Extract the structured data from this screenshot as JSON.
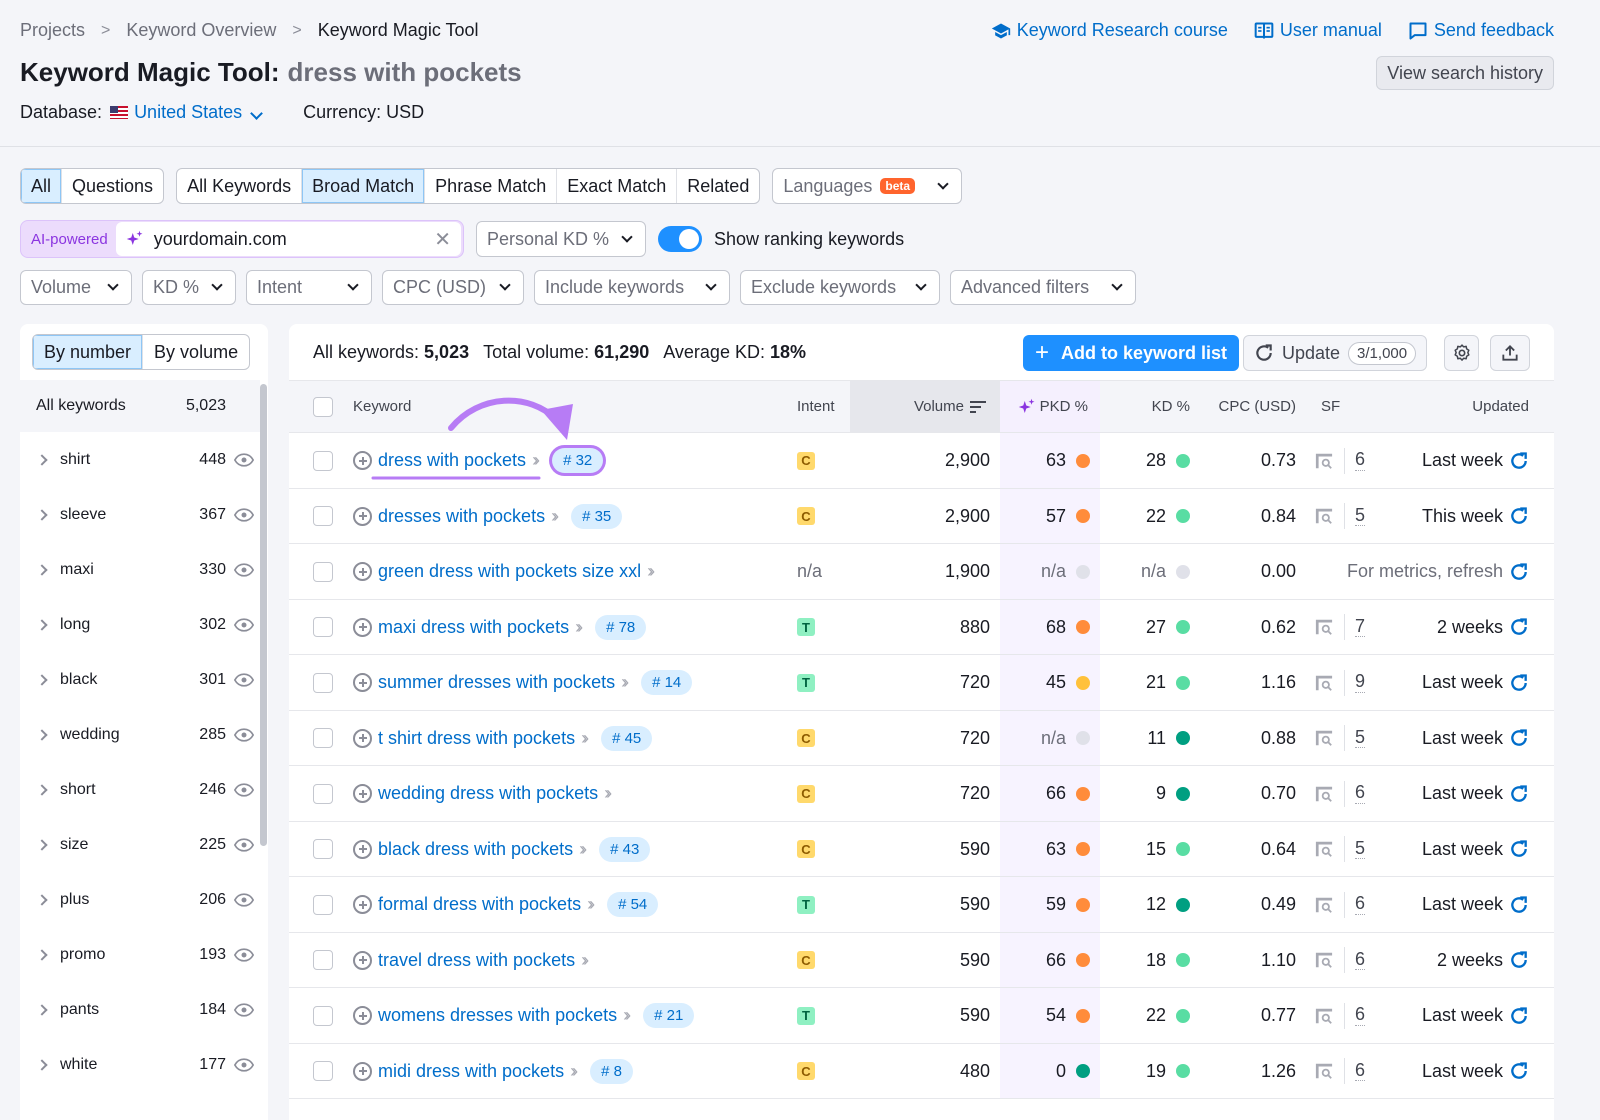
{
  "breadcrumb": [
    "Projects",
    "Keyword Overview",
    "Keyword Magic Tool"
  ],
  "header": {
    "title": "Keyword Magic Tool:",
    "query": "dress with pockets",
    "database_label": "Database:",
    "database_value": "United States",
    "currency": "Currency: USD",
    "links": {
      "course": "Keyword Research course",
      "manual": "User manual",
      "feedback": "Send feedback"
    },
    "history_button": "View search history"
  },
  "colors": {
    "accent": "#006dca",
    "primary_button": "#1e90ff",
    "ai_purple": "#8b35e0",
    "beta_badge": "#ff642d"
  },
  "filters": {
    "type_tabs": [
      "All",
      "Questions"
    ],
    "type_active": "All",
    "match_tabs": [
      "All Keywords",
      "Broad Match",
      "Phrase Match",
      "Exact Match",
      "Related"
    ],
    "match_active": "Broad Match",
    "languages": "Languages",
    "beta": "beta",
    "ai_label": "AI-powered",
    "domain_value": "yourdomain.com",
    "personal_kd": "Personal KD %",
    "show_ranking": "Show ranking keywords",
    "show_ranking_on": true,
    "dropdowns": [
      "Volume",
      "KD %",
      "Intent",
      "CPC (USD)",
      "Include keywords",
      "Exclude keywords",
      "Advanced filters"
    ]
  },
  "sidebar": {
    "tabs": [
      "By number",
      "By volume"
    ],
    "active_tab": "By number",
    "all_label": "All keywords",
    "all_count": "5,023",
    "groups": [
      {
        "label": "shirt",
        "count": "448"
      },
      {
        "label": "sleeve",
        "count": "367"
      },
      {
        "label": "maxi",
        "count": "330"
      },
      {
        "label": "long",
        "count": "302"
      },
      {
        "label": "black",
        "count": "301"
      },
      {
        "label": "wedding",
        "count": "285"
      },
      {
        "label": "short",
        "count": "246"
      },
      {
        "label": "size",
        "count": "225"
      },
      {
        "label": "plus",
        "count": "206"
      },
      {
        "label": "promo",
        "count": "193"
      },
      {
        "label": "pants",
        "count": "184"
      },
      {
        "label": "white",
        "count": "177"
      }
    ]
  },
  "summary": {
    "all_label": "All keywords:",
    "all_value": "5,023",
    "volume_label": "Total volume:",
    "volume_value": "61,290",
    "kd_label": "Average KD:",
    "kd_value": "18%"
  },
  "toolbar": {
    "add_button": "Add to keyword list",
    "update_button": "Update",
    "update_count": "3/1,000"
  },
  "table": {
    "headers": {
      "keyword": "Keyword",
      "intent": "Intent",
      "volume": "Volume",
      "pkd": "PKD %",
      "kd": "KD %",
      "cpc": "CPC (USD)",
      "sf": "SF",
      "updated": "Updated"
    },
    "rows": [
      {
        "keyword": "dress with pockets",
        "rank": "# 32",
        "highlight": true,
        "intent": "C",
        "volume": "2,900",
        "pkd": "63",
        "pkd_color": "#ff8c3b",
        "kd": "28",
        "kd_color": "#59dda3",
        "cpc": "0.73",
        "sf": "6",
        "updated": "Last week"
      },
      {
        "keyword": "dresses with pockets",
        "rank": "# 35",
        "intent": "C",
        "volume": "2,900",
        "pkd": "57",
        "pkd_color": "#ff8c3b",
        "kd": "22",
        "kd_color": "#59dda3",
        "cpc": "0.84",
        "sf": "5",
        "updated": "This week"
      },
      {
        "keyword": "green dress with pockets size xxl",
        "rank": "",
        "intent": "n/a",
        "volume": "1,900",
        "pkd": "n/a",
        "pkd_color": "#e0e1e9",
        "kd": "n/a",
        "kd_color": "#e0e1e9",
        "cpc": "0.00",
        "sf": "",
        "updated": "For metrics, refresh"
      },
      {
        "keyword": "maxi dress with pockets",
        "rank": "# 78",
        "intent": "T",
        "volume": "880",
        "pkd": "68",
        "pkd_color": "#ff8c3b",
        "kd": "27",
        "kd_color": "#59dda3",
        "cpc": "0.62",
        "sf": "7",
        "updated": "2 weeks"
      },
      {
        "keyword": "summer dresses with pockets",
        "rank": "# 14",
        "intent": "T",
        "volume": "720",
        "pkd": "45",
        "pkd_color": "#ffc13b",
        "kd": "21",
        "kd_color": "#59dda3",
        "cpc": "1.16",
        "sf": "9",
        "updated": "Last week"
      },
      {
        "keyword": "t shirt dress with pockets",
        "rank": "# 45",
        "intent": "C",
        "volume": "720",
        "pkd": "n/a",
        "pkd_color": "#e0e1e9",
        "kd": "11",
        "kd_color": "#009f81",
        "cpc": "0.88",
        "sf": "5",
        "updated": "Last week"
      },
      {
        "keyword": "wedding dress with pockets",
        "rank": "",
        "intent": "C",
        "volume": "720",
        "pkd": "66",
        "pkd_color": "#ff8c3b",
        "kd": "9",
        "kd_color": "#009f81",
        "cpc": "0.70",
        "sf": "6",
        "updated": "Last week"
      },
      {
        "keyword": "black dress with pockets",
        "rank": "# 43",
        "intent": "C",
        "volume": "590",
        "pkd": "63",
        "pkd_color": "#ff8c3b",
        "kd": "15",
        "kd_color": "#59dda3",
        "cpc": "0.64",
        "sf": "5",
        "updated": "Last week"
      },
      {
        "keyword": "formal dress with pockets",
        "rank": "# 54",
        "intent": "T",
        "volume": "590",
        "pkd": "59",
        "pkd_color": "#ff8c3b",
        "kd": "12",
        "kd_color": "#009f81",
        "cpc": "0.49",
        "sf": "6",
        "updated": "Last week"
      },
      {
        "keyword": "travel dress with pockets",
        "rank": "",
        "intent": "C",
        "volume": "590",
        "pkd": "66",
        "pkd_color": "#ff8c3b",
        "kd": "18",
        "kd_color": "#59dda3",
        "cpc": "1.10",
        "sf": "6",
        "updated": "2 weeks"
      },
      {
        "keyword": "womens dresses with pockets",
        "rank": "# 21",
        "intent": "T",
        "volume": "590",
        "pkd": "54",
        "pkd_color": "#ff8c3b",
        "kd": "22",
        "kd_color": "#59dda3",
        "cpc": "0.77",
        "sf": "6",
        "updated": "Last week"
      },
      {
        "keyword": "midi dress with pockets",
        "rank": "# 8",
        "intent": "C",
        "volume": "480",
        "pkd": "0",
        "pkd_color": "#009f81",
        "kd": "19",
        "kd_color": "#59dda3",
        "cpc": "1.26",
        "sf": "6",
        "updated": "Last week"
      }
    ]
  }
}
